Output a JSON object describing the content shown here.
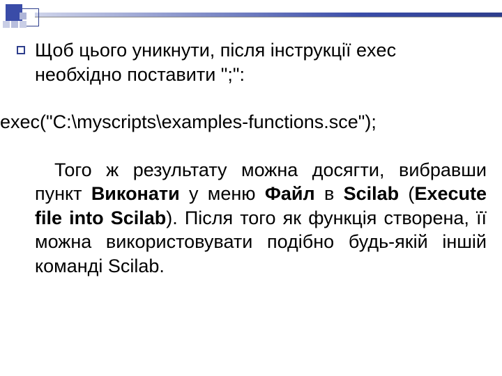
{
  "para1": "Щоб цього уникнути, після інструкції exec необхідно поставити \";\":",
  "code": "exec(\"C:\\myscripts\\examples-functions.sce\");",
  "para2_pre": "Того ж результату можна досягти, вибравши пункт ",
  "bold1": "Виконати",
  "para2_mid1": " у меню ",
  "bold2": "Файл",
  "para2_mid2": " в ",
  "bold3": "Scilab",
  "para2_mid3": " (",
  "bold4": "Execute file into Scilab",
  "para2_post": "). Після того як функція створена, її можна використовувати подібно будь-якій  іншій команді Scilab."
}
